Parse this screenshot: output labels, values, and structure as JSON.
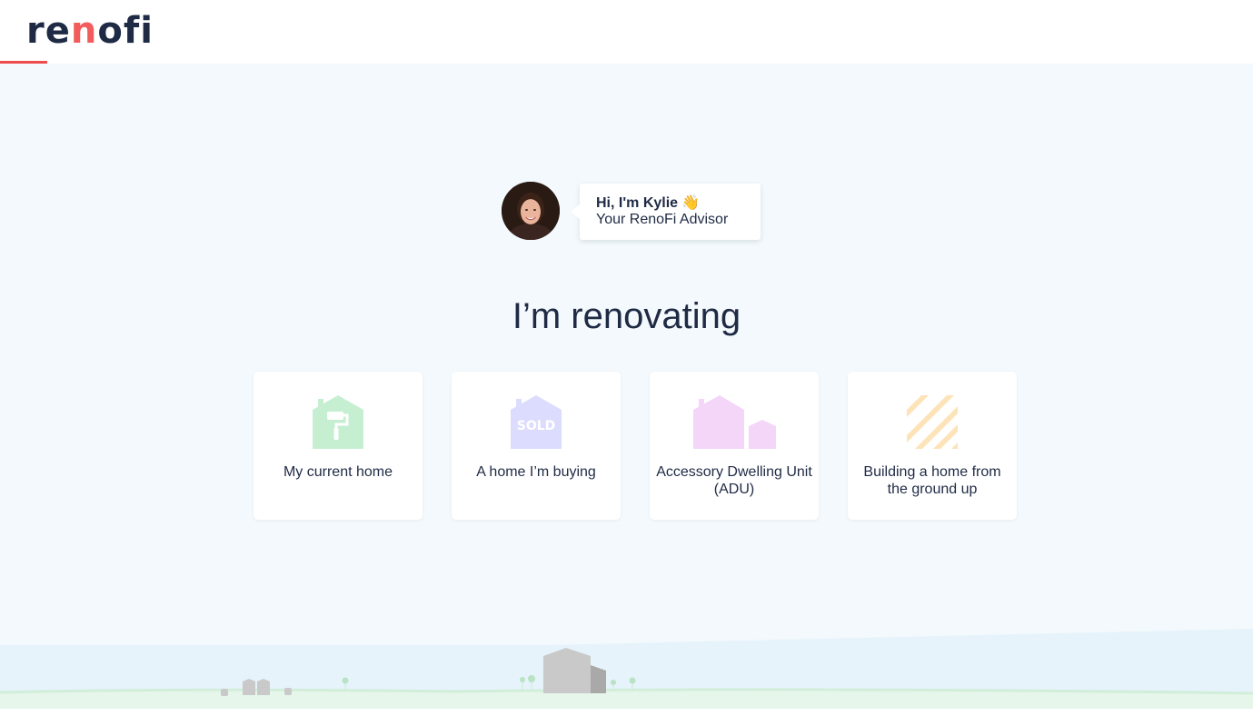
{
  "header": {
    "logo_prefix": "re",
    "logo_accent": "n",
    "logo_suffix": "ofi",
    "progress_fraction": 0.038
  },
  "advisor": {
    "greeting": "Hi, I'm Kylie",
    "role": "Your RenoFi Advisor",
    "wave_emoji": "👋",
    "avatar_icon": "advisor-photo"
  },
  "main": {
    "heading": "I’m renovating"
  },
  "options": [
    {
      "label": "My current home",
      "icon": "house-paint-roller-icon",
      "color": "#c6efd2"
    },
    {
      "label": "A home I’m buying",
      "icon": "house-sold-icon",
      "sold_text": "SOLD",
      "color": "#dcdcff"
    },
    {
      "label": "Accessory Dwelling Unit (ADU)",
      "icon": "two-houses-icon",
      "color": "#f3d6f8"
    },
    {
      "label": "Building a home from the ground up",
      "icon": "construction-stripes-icon",
      "color": "#fde3b8"
    }
  ],
  "colors": {
    "accent": "#f25c5c",
    "navy": "#1f2a44",
    "background": "#f3f9fc"
  }
}
